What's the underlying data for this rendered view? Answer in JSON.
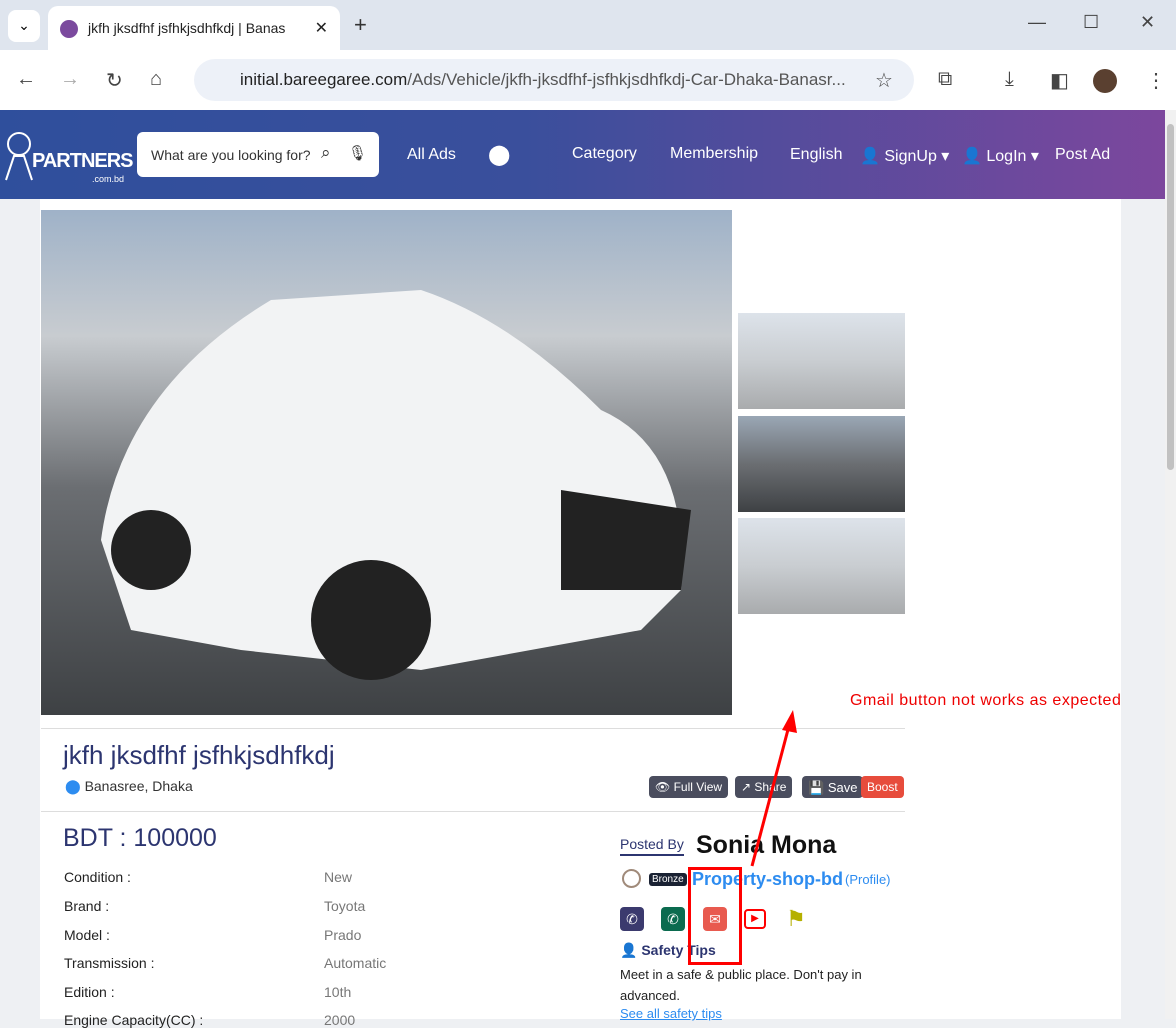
{
  "browser": {
    "tab_title": "jkfh jksdfhf jsfhkjsdhfkdj | Banas",
    "url_host": "initial.bareegaree.com",
    "url_path": "/Ads/Vehicle/jkfh-jksdfhf-jsfhkjsdhfkdj-Car-Dhaka-Banasr..."
  },
  "header": {
    "logo_name": "PARTNERS",
    "logo_sub": ".com.bd",
    "search_placeholder": "What are you looking for?",
    "nav": [
      "All Ads",
      "Category",
      "Membership",
      "English",
      "SignUp",
      "LogIn",
      "Post Ad"
    ]
  },
  "ad": {
    "title": "jkfh jksdfhf jsfhkjsdhfkdj",
    "location": "Banasree, Dhaka",
    "buttons": {
      "full_view": "Full View",
      "share": "Share",
      "save": "Save",
      "boost": "Boost"
    },
    "price": "BDT : 100000",
    "specs": [
      {
        "label": "Condition :",
        "value": "New"
      },
      {
        "label": "Brand :",
        "value": "Toyota"
      },
      {
        "label": "Model :",
        "value": "Prado"
      },
      {
        "label": "Transmission :",
        "value": "Automatic"
      },
      {
        "label": "Edition :",
        "value": "10th"
      },
      {
        "label": "Engine Capacity(CC) :",
        "value": "2000"
      }
    ]
  },
  "seller": {
    "posted_by": "Posted By",
    "name": "Sonia Mona",
    "badge": "Bronze",
    "shop": "Property-shop-bd",
    "profile": "(Profile)",
    "safety_title": "Safety Tips",
    "safety_text": "Meet in a safe & public place. Don't pay in advanced.",
    "see_all": "See all safety tips"
  },
  "annotation": {
    "text": "Gmail button not works as expected",
    "color": "#ff0000"
  }
}
